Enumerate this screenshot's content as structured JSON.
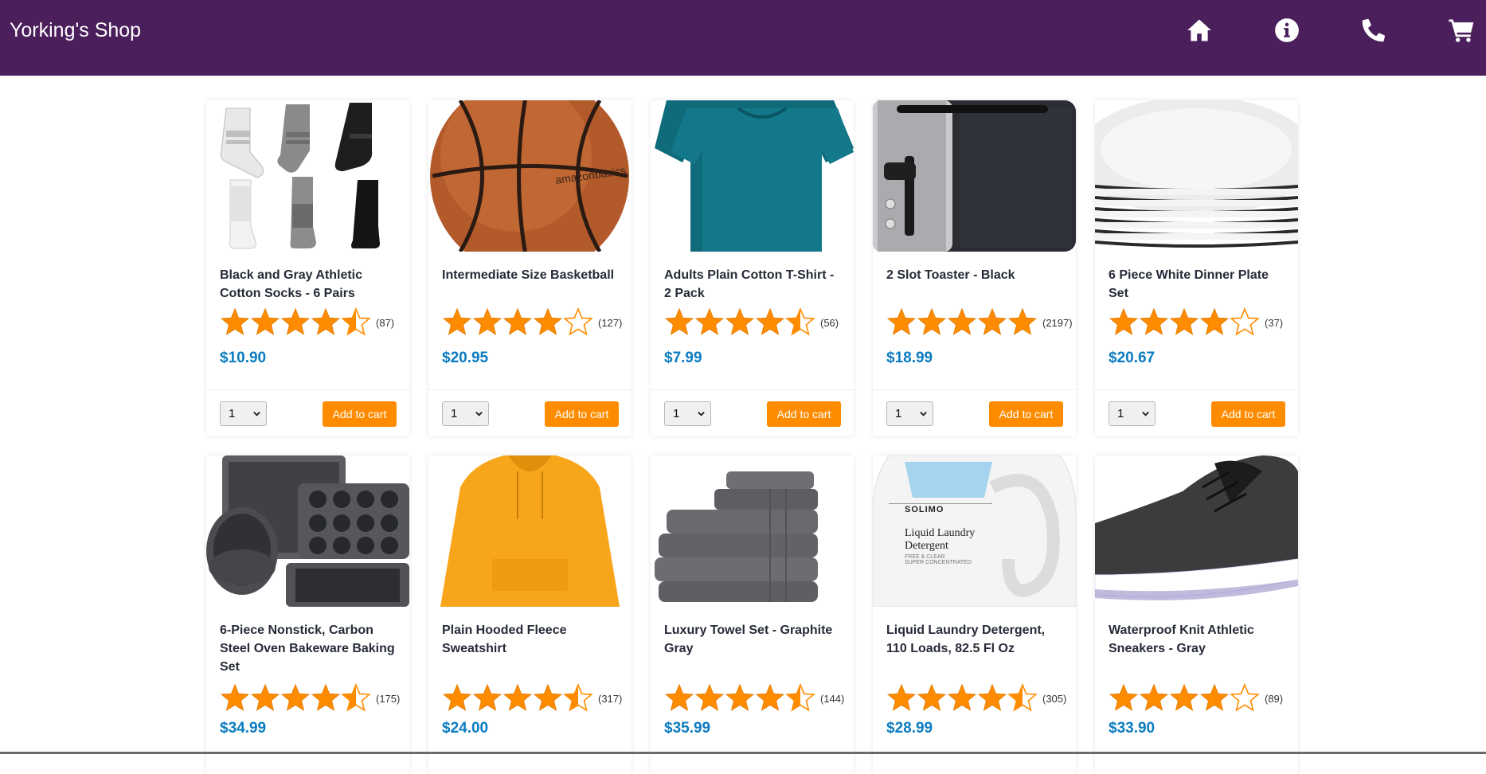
{
  "header": {
    "title": "Yorking's Shop",
    "icons": [
      "home-icon",
      "info-icon",
      "phone-icon",
      "cart-icon"
    ]
  },
  "colors": {
    "header_bg": "#4b1f5c",
    "price": "#0b7cc1",
    "button": "#ff8c00",
    "star": "#ff8c00"
  },
  "products": [
    {
      "name": "Black and Gray Athletic Cotton Socks - 6 Pairs",
      "rating": 4.5,
      "reviews": "(87)",
      "price": "$10.90",
      "qty": "1",
      "button": "Add to cart",
      "image": "socks"
    },
    {
      "name": "Intermediate Size Basketball",
      "rating": 4,
      "reviews": "(127)",
      "price": "$20.95",
      "qty": "1",
      "button": "Add to cart",
      "image": "basketball"
    },
    {
      "name": "Adults Plain Cotton T-Shirt - 2 Pack",
      "rating": 4.5,
      "reviews": "(56)",
      "price": "$7.99",
      "qty": "1",
      "button": "Add to cart",
      "image": "tshirt"
    },
    {
      "name": "2 Slot Toaster - Black",
      "rating": 5,
      "reviews": "(2197)",
      "price": "$18.99",
      "qty": "1",
      "button": "Add to cart",
      "image": "toaster"
    },
    {
      "name": "6 Piece White Dinner Plate Set",
      "rating": 4,
      "reviews": "(37)",
      "price": "$20.67",
      "qty": "1",
      "button": "Add to cart",
      "image": "plates"
    },
    {
      "name": "6-Piece Nonstick, Carbon Steel Oven Bakeware Baking Set",
      "rating": 4.5,
      "reviews": "(175)",
      "price": "$34.99",
      "image": "bakeware"
    },
    {
      "name": "Plain Hooded Fleece Sweatshirt",
      "rating": 4.5,
      "reviews": "(317)",
      "price": "$24.00",
      "image": "hoodie"
    },
    {
      "name": "Luxury Towel Set - Graphite Gray",
      "rating": 4.5,
      "reviews": "(144)",
      "price": "$35.99",
      "image": "towels"
    },
    {
      "name": "Liquid Laundry Detergent, 110 Loads, 82.5 Fl Oz",
      "rating": 4.5,
      "reviews": "(305)",
      "price": "$28.99",
      "image": "detergent",
      "label": {
        "brand": "SOLIMO",
        "line1": "Liquid Laundry",
        "line2": "Detergent",
        "line3": "FREE & CLEAR",
        "line4": "SUPER CONCENTRATED"
      }
    },
    {
      "name": "Waterproof Knit Athletic Sneakers - Gray",
      "rating": 4,
      "reviews": "(89)",
      "price": "$33.90",
      "image": "sneakers"
    }
  ]
}
